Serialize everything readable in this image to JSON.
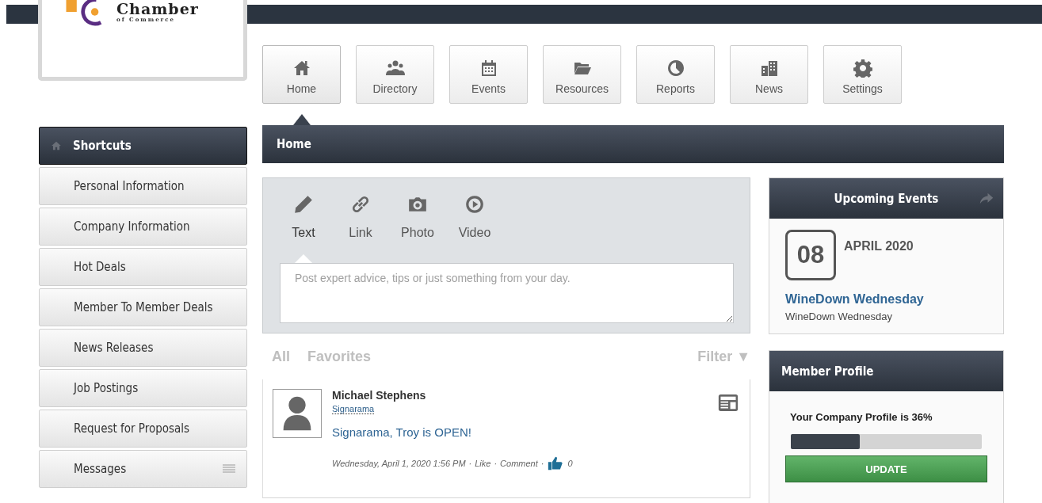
{
  "logo": {
    "name": "Chamber",
    "tagline": "of Commerce"
  },
  "nav": [
    {
      "label": "Home",
      "selected": true
    },
    {
      "label": "Directory",
      "selected": false
    },
    {
      "label": "Events",
      "selected": false
    },
    {
      "label": "Resources",
      "selected": false
    },
    {
      "label": "Reports",
      "selected": false
    },
    {
      "label": "News",
      "selected": false
    },
    {
      "label": "Settings",
      "selected": false
    }
  ],
  "sidebar": {
    "title": "Shortcuts",
    "items": [
      {
        "label": "Personal Information"
      },
      {
        "label": "Company Information"
      },
      {
        "label": "Hot Deals"
      },
      {
        "label": "Member To Member Deals"
      },
      {
        "label": "News Releases"
      },
      {
        "label": "Job Postings"
      },
      {
        "label": "Request for Proposals"
      },
      {
        "label": "Messages",
        "kind": "menu"
      }
    ]
  },
  "page_title": "Home",
  "composer": {
    "tabs": [
      {
        "label": "Text",
        "selected": true
      },
      {
        "label": "Link",
        "selected": false
      },
      {
        "label": "Photo",
        "selected": false
      },
      {
        "label": "Video",
        "selected": false
      }
    ],
    "placeholder": "Post expert advice, tips or just something from your day."
  },
  "feed_filters": [
    "All",
    "Favorites"
  ],
  "filter": "Filter ▼",
  "posts": [
    {
      "author": "Michael Stephens",
      "company": "Signarama",
      "text": "Signarama, Troy is OPEN!",
      "time": "Wednesday, April 1, 2020 1:56 PM",
      "separator": "·",
      "actions": [
        "Like",
        "Comment"
      ],
      "likes": "0"
    }
  ],
  "upcoming_events": {
    "title": "Upcoming Events",
    "day": "08",
    "month": "APRIL 2020",
    "event_title": "WineDown Wednesday",
    "event_desc": "WineDown Wednesday"
  },
  "member_profile": {
    "title": "Member Profile",
    "label": "Your Company Profile is 36%",
    "level": 0.36,
    "button": "UPDATE"
  }
}
